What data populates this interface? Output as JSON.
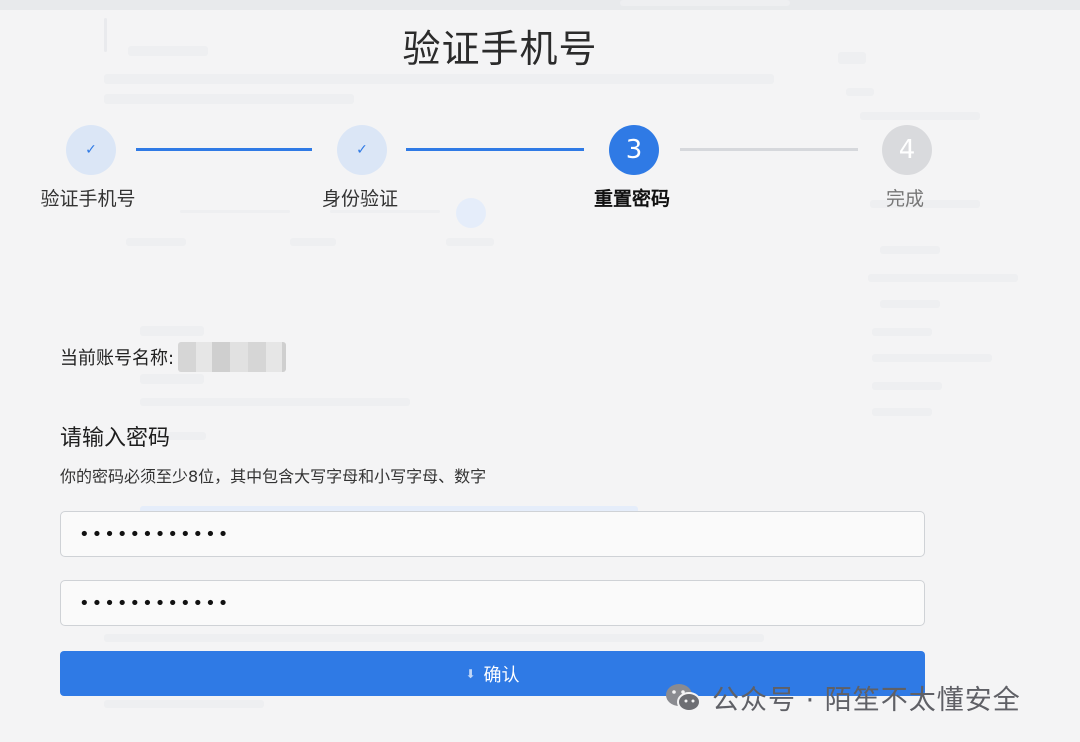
{
  "page": {
    "title": "验证手机号"
  },
  "stepper": {
    "steps": [
      {
        "label": "验证手机号",
        "state": "done",
        "mark": "✓"
      },
      {
        "label": "身份验证",
        "state": "done",
        "mark": "✓"
      },
      {
        "label": "重置密码",
        "state": "active",
        "mark": "3"
      },
      {
        "label": "完成",
        "state": "todo",
        "mark": "4"
      }
    ]
  },
  "account": {
    "label": "当前账号名称:"
  },
  "password": {
    "heading": "请输入密码",
    "hint": "你的密码必须至少8位，其中包含大写字母和小写字母、数字",
    "field1_value": "••••••••••••",
    "field2_value": "••••••••••••"
  },
  "confirm": {
    "label": "确认"
  },
  "watermark": {
    "text": "公众号 · 陌笙不太懂安全"
  },
  "colors": {
    "accent": "#2f7ae5",
    "done_circle": "#dbe6f6",
    "todo_circle": "#d9dadd"
  },
  "icons": {
    "done": "check-icon",
    "watermark": "wechat-icon"
  }
}
